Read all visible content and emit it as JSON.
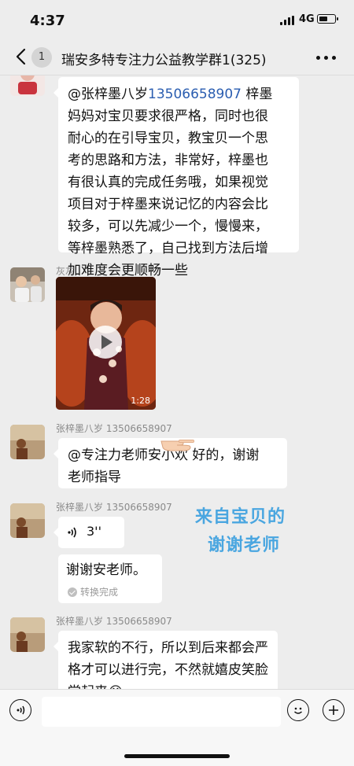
{
  "status_bar": {
    "time": "4:37",
    "network": "4G",
    "battery_level": 0.45
  },
  "nav": {
    "unread_count": "1",
    "title": "瑞安多特专注力公益教学群1(325)"
  },
  "messages": [
    {
      "type": "text",
      "sender": "",
      "lines": [
        {
          "mention": "@张梓墨八岁",
          "phone": "13506658907",
          "rest": " 梓墨"
        },
        {
          "text": "妈妈对宝贝要求很严格，同时也很"
        },
        {
          "text": "耐心的在引导宝贝，教宝贝一个思"
        },
        {
          "text": "考的思路和方法，非常好，梓墨也"
        },
        {
          "text": "有很认真的完成任务哦，如果视觉"
        },
        {
          "text": "项目对于梓墨来说记忆的内容会比"
        },
        {
          "text": "较多，可以先减少一个，慢慢来，"
        },
        {
          "text": "等梓墨熟悉了，自己找到方法后增"
        },
        {
          "text": "加难度会更顺畅一些"
        }
      ]
    },
    {
      "type": "video",
      "sender": "灰灰",
      "duration": "1:28"
    },
    {
      "type": "text",
      "sender": "张梓墨八岁 13506658907",
      "lines": [
        {
          "text": "@专注力老师安小欢 好的，谢谢"
        },
        {
          "text": "老师指导"
        }
      ]
    },
    {
      "type": "voice",
      "sender": "张梓墨八岁 13506658907",
      "voice_length": "3''",
      "transcript": "谢谢安老师。",
      "transcript_status": "转换完成"
    },
    {
      "type": "text",
      "sender": "张梓墨八岁 13506658907",
      "lines": [
        {
          "text": "我家软的不行，所以到后来都会严"
        },
        {
          "text": "格才可以进行完，不然就嬉皮笑脸"
        },
        {
          "text": "堂起来😭"
        }
      ]
    }
  ],
  "overlay": {
    "line1": "来自宝贝的",
    "line2": "谢谢老师",
    "color": "#4aa6e0"
  },
  "input_bar": {
    "placeholder": ""
  },
  "colors": {
    "background": "#ededed",
    "bubble": "#ffffff",
    "link": "#2a5db0"
  }
}
